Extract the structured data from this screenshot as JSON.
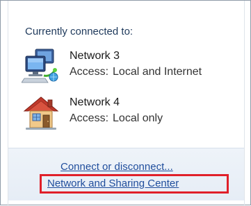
{
  "flyout": {
    "header": "Currently connected to:",
    "networks": [
      {
        "name": "Network 3",
        "access_label": "Access:",
        "access_value": "Local and Internet",
        "icon": "network-computer-icon"
      },
      {
        "name": "Network 4",
        "access_label": "Access:",
        "access_value": "Local only",
        "icon": "home-network-icon"
      }
    ],
    "links": {
      "connect": "Connect or disconnect...",
      "sharing_center": "Network and Sharing Center"
    },
    "colors": {
      "link": "#1f4d9c",
      "highlight_box": "#e0202a",
      "header": "#1e395b"
    }
  }
}
